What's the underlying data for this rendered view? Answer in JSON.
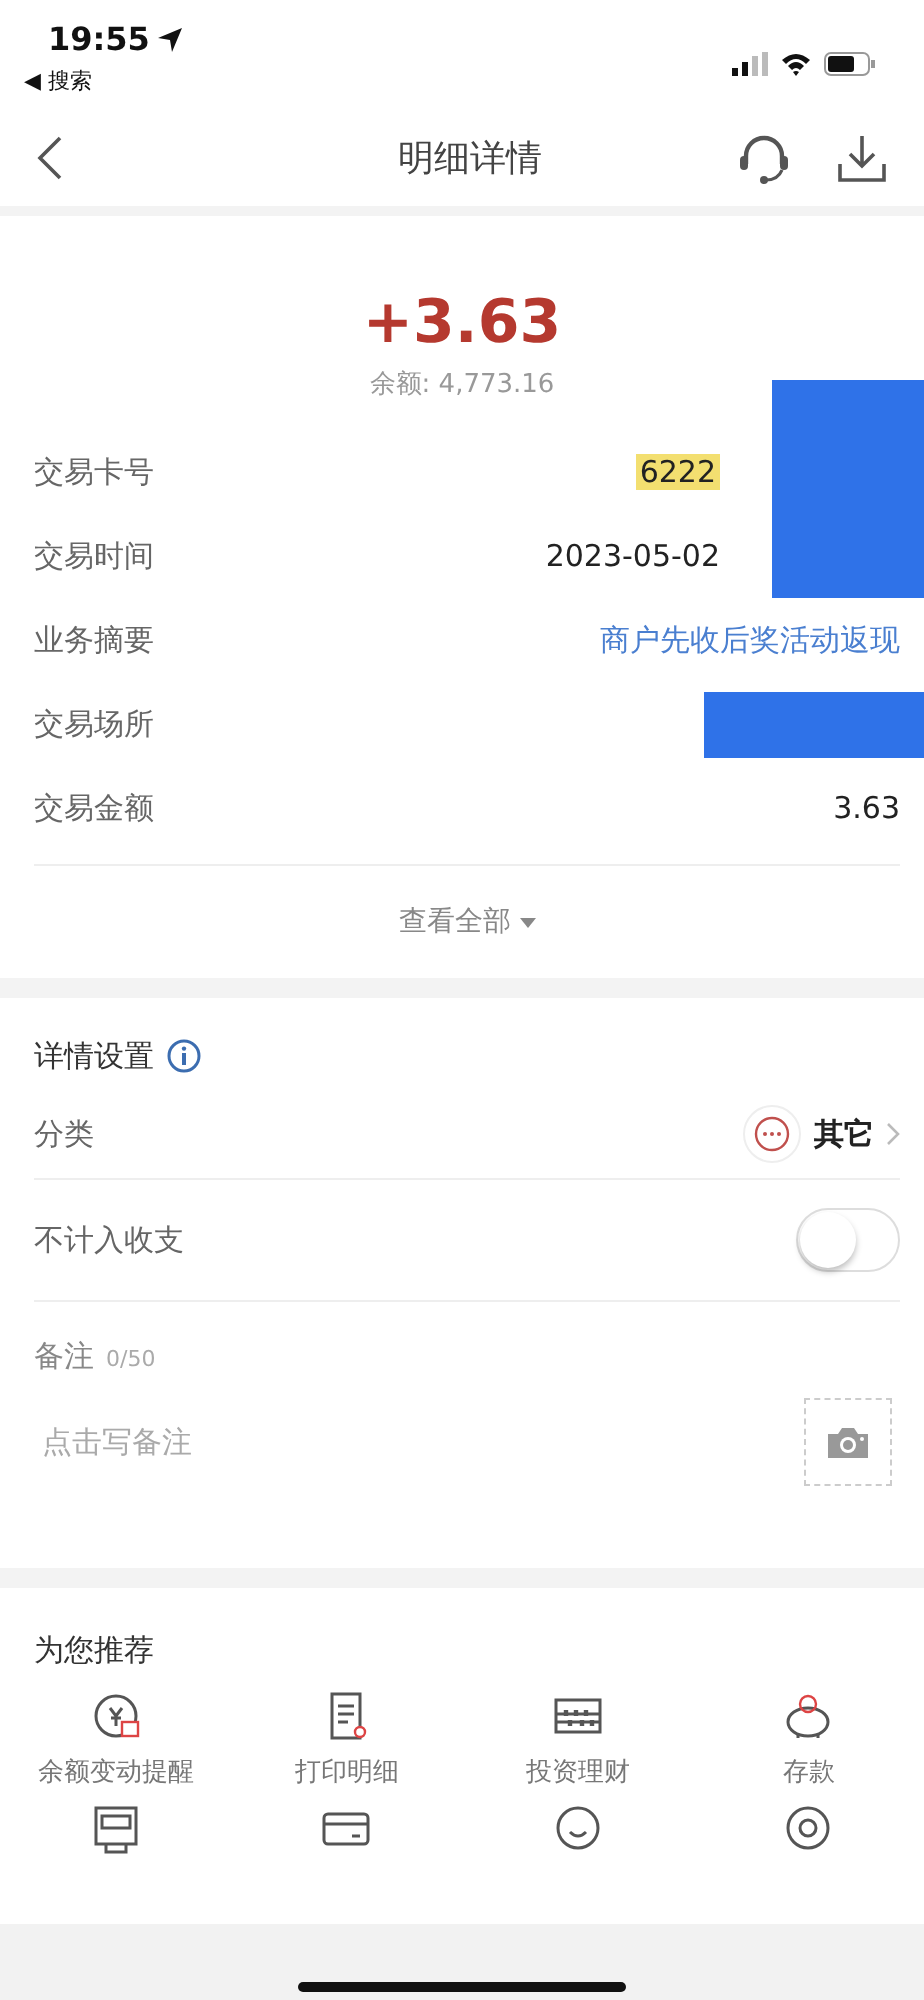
{
  "status_bar": {
    "time": "19:55",
    "back_app": "◀ 搜索"
  },
  "nav": {
    "title": "明细详情"
  },
  "summary": {
    "amount": "+3.63",
    "balance": "余额: 4,773.16"
  },
  "details": [
    {
      "label": "交易卡号",
      "value": "6222",
      "kind": "masked"
    },
    {
      "label": "交易时间",
      "value": "2023-05-02",
      "kind": "masked"
    },
    {
      "label": "业务摘要",
      "value": "商户先收后奖活动返现",
      "kind": "link"
    },
    {
      "label": "交易场所",
      "kind": "redacted"
    },
    {
      "label": "交易金额",
      "value": "3.63",
      "kind": "plain"
    }
  ],
  "view_all": "查看全部",
  "settings": {
    "title": "详情设置",
    "category_label": "分类",
    "category_value": "其它",
    "exclude_label": "不计入收支",
    "exclude_on": false,
    "note_label": "备注",
    "note_count": "0/50",
    "note_placeholder": "点击写备注"
  },
  "recommend": {
    "title": "为您推荐",
    "items": [
      {
        "label": "余额变动提醒",
        "kind": "alert"
      },
      {
        "label": "打印明细",
        "kind": "print"
      },
      {
        "label": "投资理财",
        "kind": "abacus"
      },
      {
        "label": "存款",
        "kind": "piggy"
      },
      {
        "kind": "atm"
      },
      {
        "kind": "card"
      },
      {
        "kind": "face"
      },
      {
        "kind": "coin"
      }
    ]
  }
}
